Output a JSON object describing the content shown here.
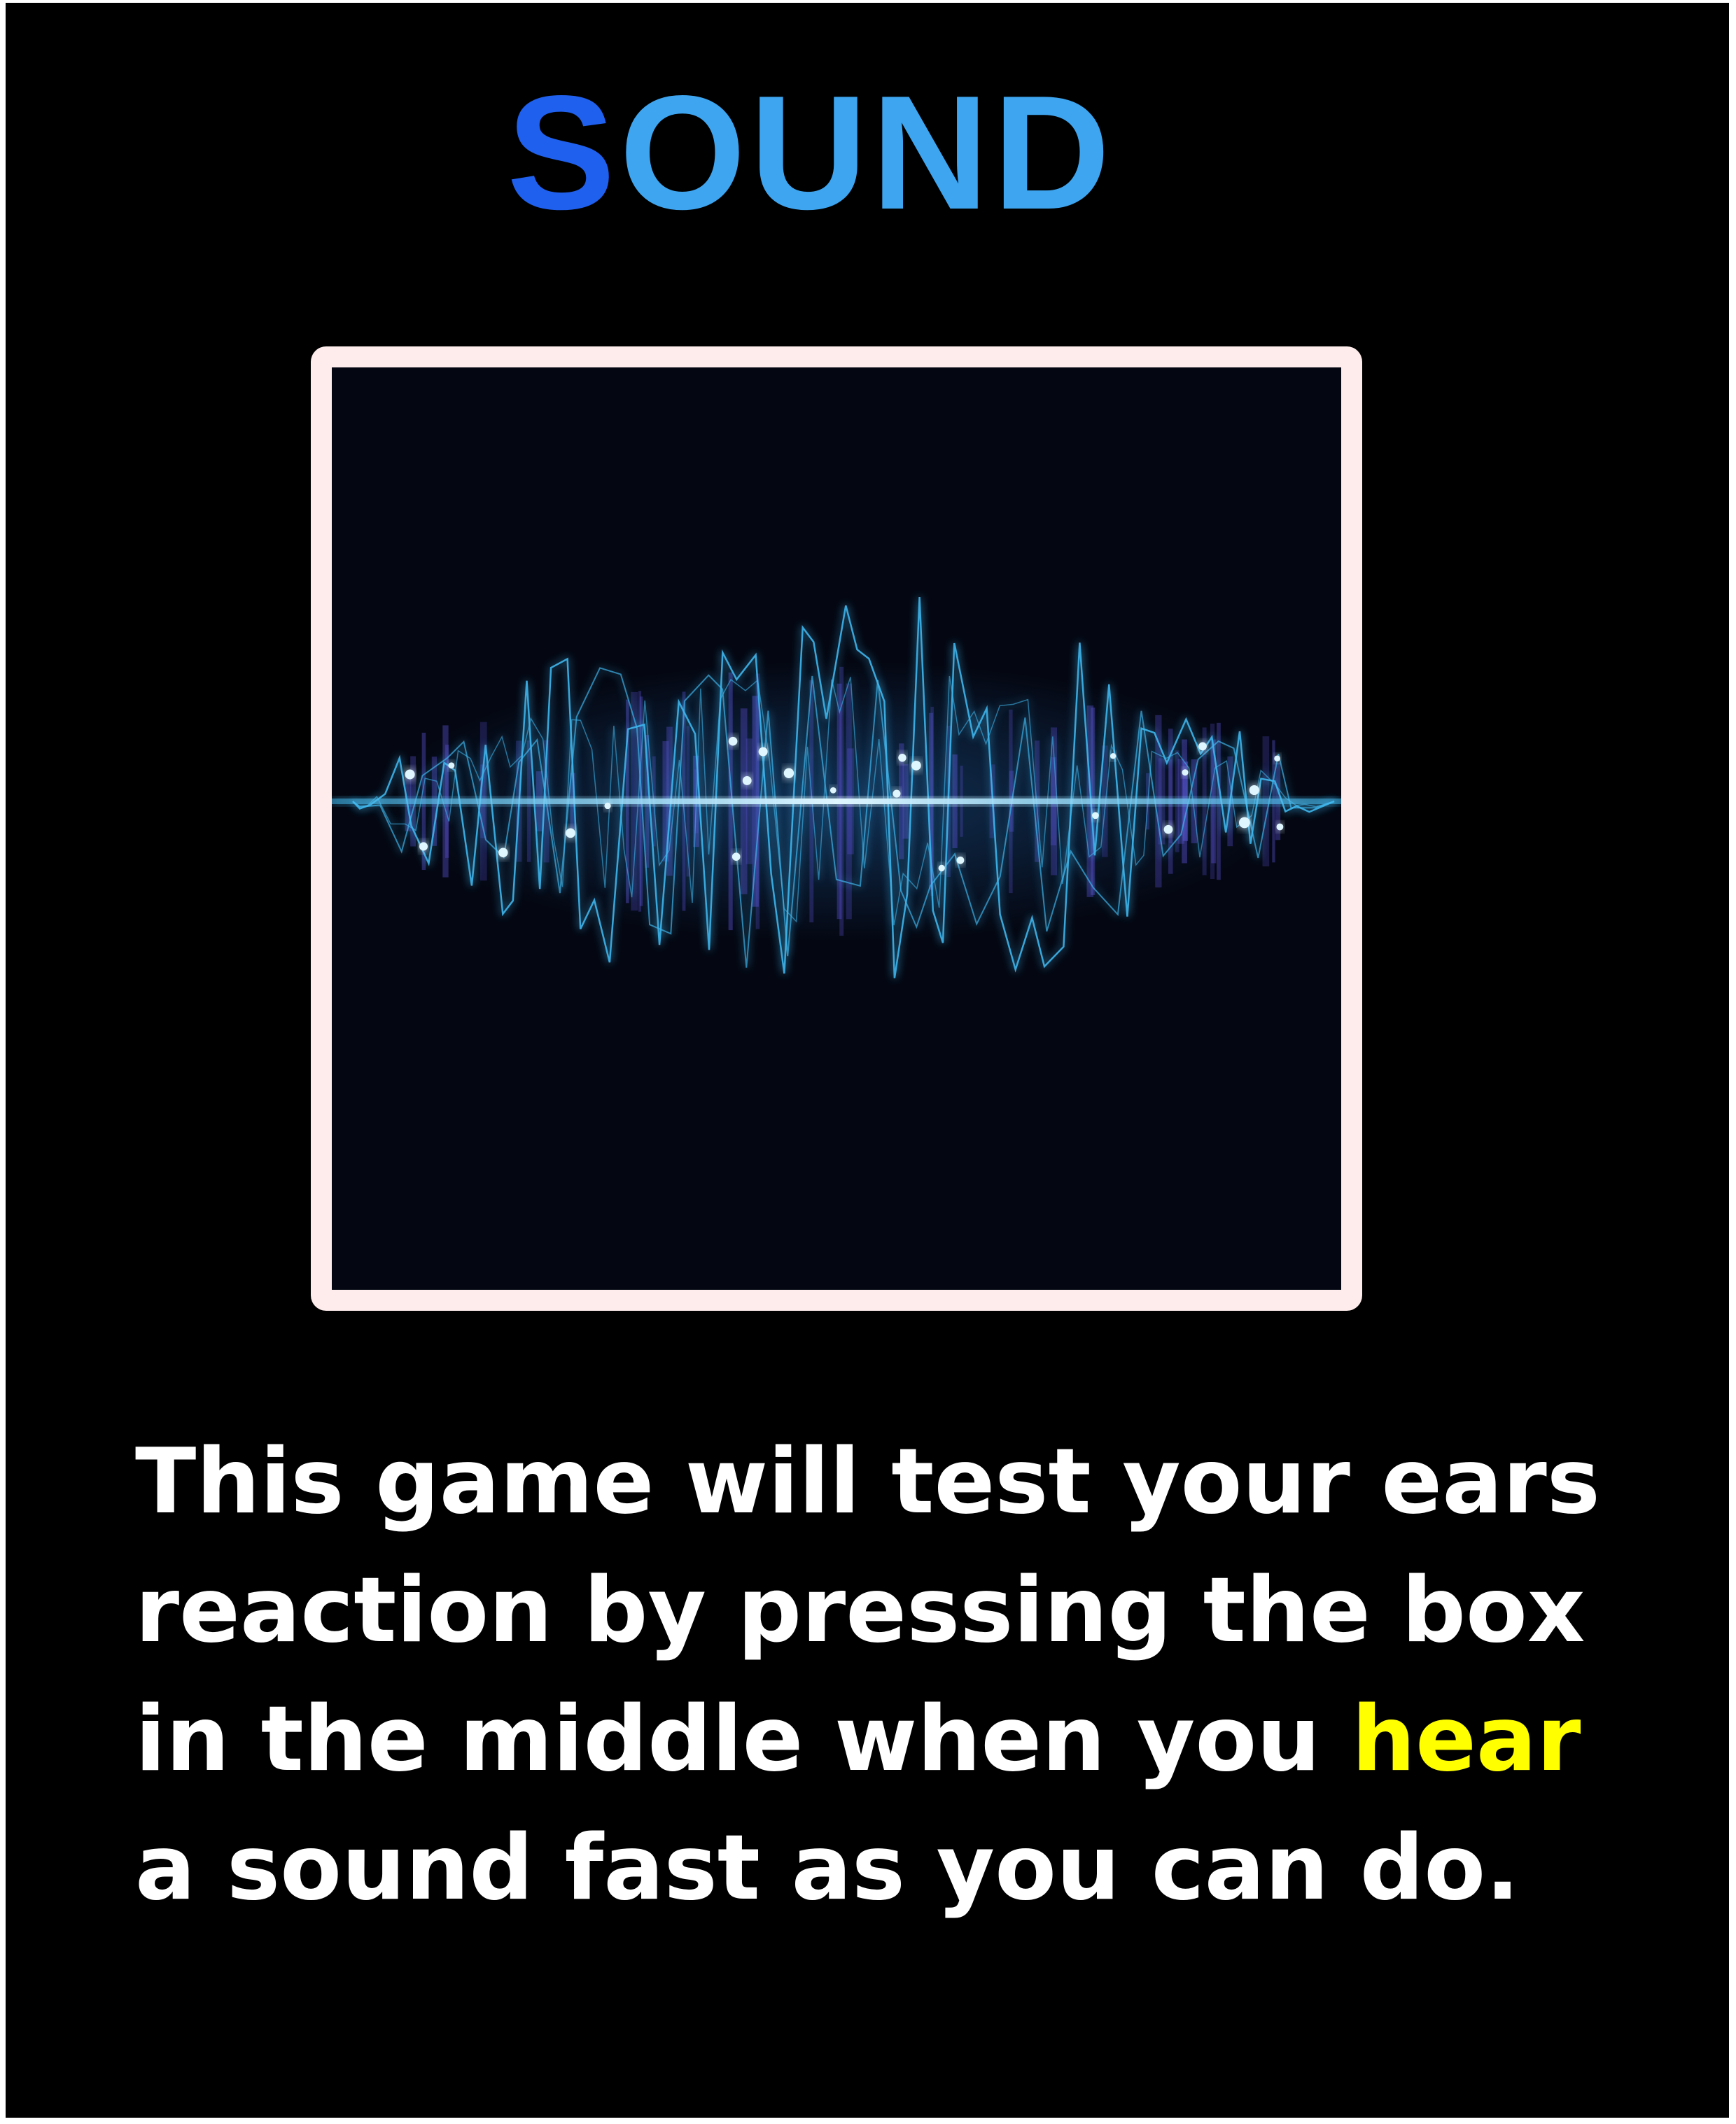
{
  "title": {
    "first_letter": "S",
    "rest": "OUND",
    "colors": {
      "first_letter": "#1f60ee",
      "rest": "#3ea5f0"
    }
  },
  "image": {
    "icon": "sound-wave-icon",
    "colors": {
      "wave": "#3fb8ef",
      "core": "#dff6ff",
      "background": "#040712",
      "frame": "#fdeceb"
    }
  },
  "description": {
    "line1": "This game will test your ears",
    "line2": "reaction by pressing the box",
    "line3_before": "in the middle when you ",
    "line3_highlight": "hear",
    "line4": "a sound fast as you can do.",
    "colors": {
      "text": "#ffffff",
      "highlight": "#ffff00"
    }
  }
}
